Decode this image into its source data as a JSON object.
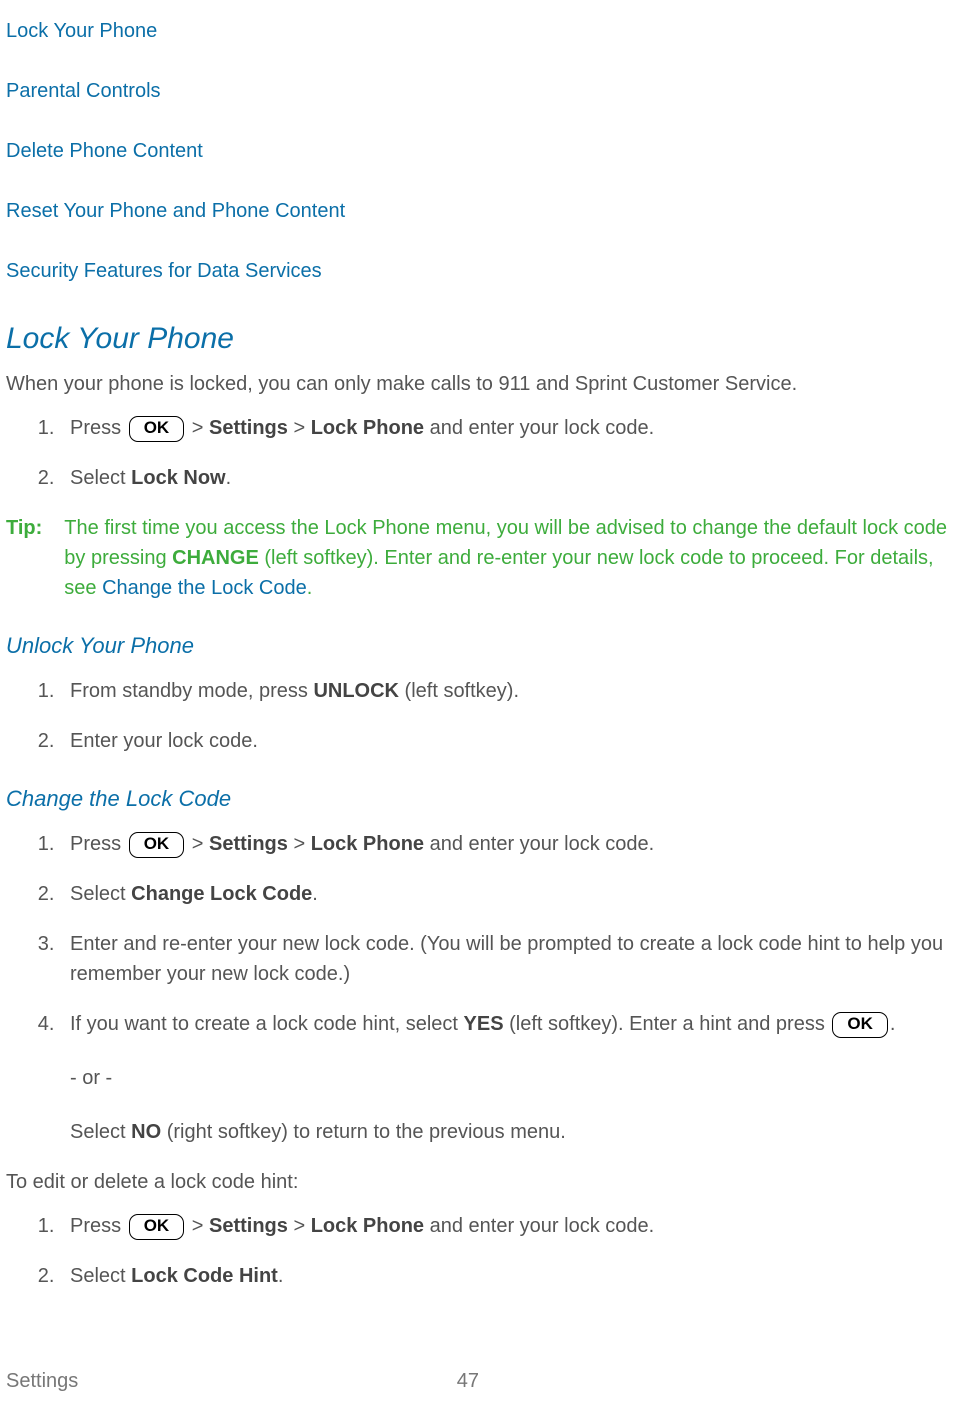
{
  "toc": {
    "items": [
      "Lock Your Phone",
      "Parental Controls",
      "Delete Phone Content",
      "Reset Your Phone and Phone Content",
      "Security Features for Data Services"
    ]
  },
  "ok_label": "OK",
  "lock": {
    "heading": "Lock Your Phone",
    "intro": "When your phone is locked, you can only make calls to 911 and Sprint Customer Service.",
    "step1_a": "Press ",
    "step1_b": " > ",
    "step1_settings": "Settings",
    "step1_c": " > ",
    "step1_lockphone": "Lock Phone",
    "step1_d": " and enter your lock code.",
    "step2_a": "Select ",
    "step2_b": "Lock Now",
    "step2_c": "."
  },
  "tip": {
    "label": "Tip:",
    "text_a": "The first time you access the Lock Phone menu, you will be advised to change the default lock code by pressing ",
    "text_change": "CHANGE",
    "text_b": " (left softkey). Enter and re-enter your new lock code to proceed. For details, see ",
    "link": "Change the Lock Code",
    "text_c": "."
  },
  "unlock": {
    "heading": "Unlock Your Phone",
    "step1_a": "From standby mode, press ",
    "step1_b": "UNLOCK",
    "step1_c": " (left softkey).",
    "step2": "Enter your lock code."
  },
  "change": {
    "heading": "Change the Lock Code",
    "step1_a": "Press ",
    "step1_b": " > ",
    "step1_settings": "Settings",
    "step1_c": " > ",
    "step1_lockphone": "Lock Phone",
    "step1_d": " and enter your lock code.",
    "step2_a": "Select ",
    "step2_b": "Change Lock Code",
    "step2_c": ".",
    "step3": "Enter and re-enter your new lock code. (You will be prompted to create a lock code hint to help you remember your new lock code.)",
    "step4_a": "If you want to create a lock code hint, select ",
    "step4_yes": "YES",
    "step4_b": " (left softkey). Enter a hint and press ",
    "step4_c": ".",
    "or": "- or -",
    "alt_a": "Select ",
    "alt_no": "NO",
    "alt_b": " (right softkey) to return to the previous menu."
  },
  "editdel": {
    "intro": "To edit or delete a lock code hint:",
    "step1_a": "Press ",
    "step1_b": " > ",
    "step1_settings": "Settings",
    "step1_c": " > ",
    "step1_lockphone": "Lock Phone",
    "step1_d": " and enter your lock code.",
    "step2_a": "Select ",
    "step2_b": "Lock Code Hint",
    "step2_c": "."
  },
  "footer": {
    "section": "Settings",
    "page": "47"
  }
}
